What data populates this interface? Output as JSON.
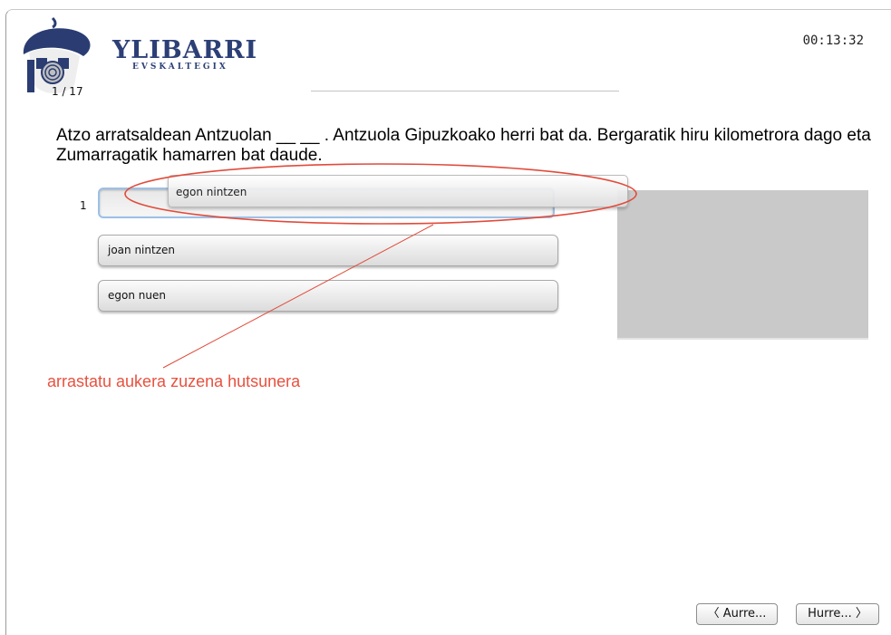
{
  "header": {
    "brand_title": "YLIBARRI",
    "brand_subtitle": "EVSKALTEGIX",
    "page_counter": "1 / 17",
    "timer": "00:13:32"
  },
  "question": {
    "text": "Atzo arratsaldean Antzuolan __ __ . Antzuola Gipuzkoako herri bat da. Bergaratik hiru kilometrora dago eta Zumarragatik hamarren bat daude."
  },
  "drop_slot": {
    "number": "1"
  },
  "options": [
    {
      "label": "egon nintzen"
    },
    {
      "label": "joan nintzen"
    },
    {
      "label": "egon nuen"
    }
  ],
  "annotation": {
    "text": "arrastatu aukera zuzena hutsunera",
    "color": "#e8513f"
  },
  "navigation": {
    "prev_label": "〈 Aurre...",
    "next_label": "Hurre... 〉"
  },
  "colors": {
    "brand": "#2c3f76",
    "image_placeholder": "#c9c9c9",
    "drop_border": "#9cc0e8"
  },
  "icons": {
    "logo": "txapela-beret-logo-icon"
  }
}
